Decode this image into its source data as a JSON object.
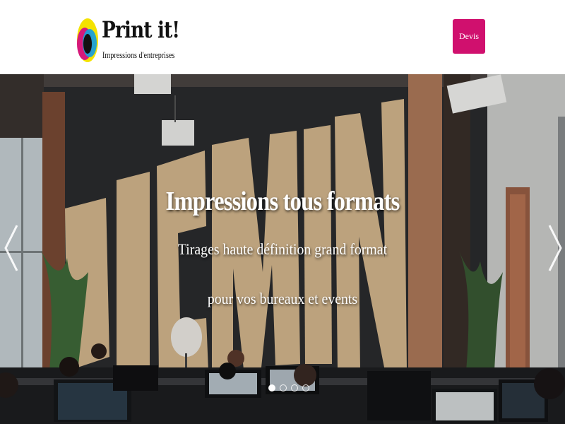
{
  "header": {
    "logo_title": "Print it!",
    "logo_subtitle": "Impressions d'entreprises",
    "cta_label": "Devis",
    "cta_color": "#d0106e"
  },
  "hero": {
    "title": "Impressions tous formats",
    "line1": "Tirages haute définition grand format",
    "line2": "pour vos bureaux et events",
    "wall_lettering": "BIGMIN",
    "slide_count": 4,
    "active_slide": 1
  },
  "icons": {
    "prev": "chevron-left-icon",
    "next": "chevron-right-icon"
  }
}
